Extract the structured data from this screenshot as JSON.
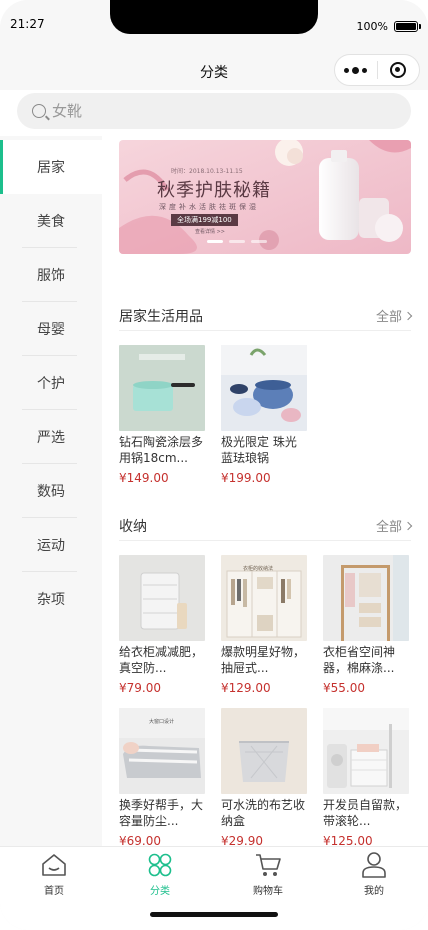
{
  "status": {
    "time": "21:27",
    "battery": "100%"
  },
  "nav": {
    "title": "分类"
  },
  "search": {
    "placeholder": "女靴"
  },
  "sidebar": {
    "items": [
      {
        "label": "居家"
      },
      {
        "label": "美食"
      },
      {
        "label": "服饰"
      },
      {
        "label": "母婴"
      },
      {
        "label": "个护"
      },
      {
        "label": "严选"
      },
      {
        "label": "数码"
      },
      {
        "label": "运动"
      },
      {
        "label": "杂项"
      }
    ]
  },
  "banner": {
    "date": "时间：2018.10.13-11.15",
    "headline": "秋季护肤秘籍",
    "subline": "深度补水活肤祛斑保湿",
    "promo": "全场满199减100",
    "link": "查看详情 >>"
  },
  "sections": [
    {
      "title": "居家生活用品",
      "all_label": "全部",
      "products": [
        {
          "name": "钻石陶瓷涂层多用锅18cm...",
          "price": "¥149.00",
          "icon": "pot-photo"
        },
        {
          "name": "极光限定 珠光蓝珐琅锅",
          "price": "¥199.00",
          "icon": "cookware-photo"
        }
      ]
    },
    {
      "title": "收纳",
      "all_label": "全部",
      "products": [
        {
          "name": "给衣柜减减肥，真空防...",
          "price": "¥79.00",
          "icon": "vacuum-bag-photo"
        },
        {
          "name": "爆款明星好物，抽屉式...",
          "price": "¥129.00",
          "icon": "wardrobe-photo",
          "tag": "衣柜的收纳法"
        },
        {
          "name": "衣柜省空间神器，棉麻涤...",
          "price": "¥55.00",
          "icon": "shelf-photo"
        },
        {
          "name": "换季好帮手，大容量防尘...",
          "price": "¥69.00",
          "icon": "storage-bag-photo",
          "tag": "大窗口设计"
        },
        {
          "name": "可水洗的布艺收纳盒",
          "price": "¥29.90",
          "icon": "fabric-box-photo"
        },
        {
          "name": "开发员自留款，带滚轮...",
          "price": "¥125.00",
          "icon": "laundry-basket-photo"
        }
      ]
    }
  ],
  "tabbar": {
    "items": [
      {
        "label": "首页",
        "icon": "home-icon"
      },
      {
        "label": "分类",
        "icon": "category-icon"
      },
      {
        "label": "购物车",
        "icon": "cart-icon"
      },
      {
        "label": "我的",
        "icon": "profile-icon"
      }
    ]
  },
  "colors": {
    "accent": "#1cbf8c",
    "price": "#c5312e",
    "banner_bg": "#f2c9d2"
  }
}
